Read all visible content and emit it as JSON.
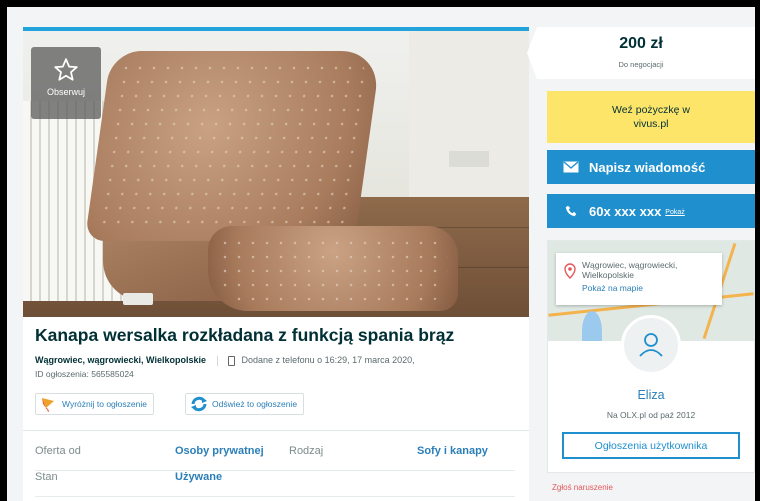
{
  "listing": {
    "watch_label": "Obserwuj",
    "title": "Kanapa wersalka rozkładana z funkcją spania brąz",
    "location": "Wągrowiec, wągrowiecki, Wielkopolskie",
    "added_text": "Dodane z telefonu",
    "added_time": "o 16:29, 17 marca 2020,",
    "ad_id": "ID ogłoszenia: 565585024",
    "promote_label": "Wyróżnij to ogłoszenie",
    "refresh_label": "Odśwież to ogłoszenie",
    "params": [
      {
        "key": "Oferta od",
        "value": "Osoby prywatnej"
      },
      {
        "key": "Rodzaj",
        "value": "Sofy i kanapy"
      },
      {
        "key": "Stan",
        "value": "Używane"
      }
    ]
  },
  "sidebar": {
    "price": "200 zł",
    "negotiable": "Do negocjacji",
    "loan_line1": "Weź pożyczkę w",
    "loan_line2": "vivus.pl",
    "message_button": "Napisz wiadomość",
    "phone_masked": "60x xxx xxx",
    "phone_show": "Pokaż",
    "map_address": "Wągrowiec, wągrowiecki, Wielkopolskie",
    "show_on_map": "Pokaż na mapie",
    "user_name": "Eliza",
    "user_since": "Na OLX.pl od paź 2012",
    "user_ads_button": "Ogłoszenia użytkownika",
    "report": "Zgłoś naruszenie"
  },
  "colors": {
    "accent": "#1f8fcd",
    "loan_bg": "#fde56a",
    "title": "#002f34",
    "report": "#e3585c"
  }
}
